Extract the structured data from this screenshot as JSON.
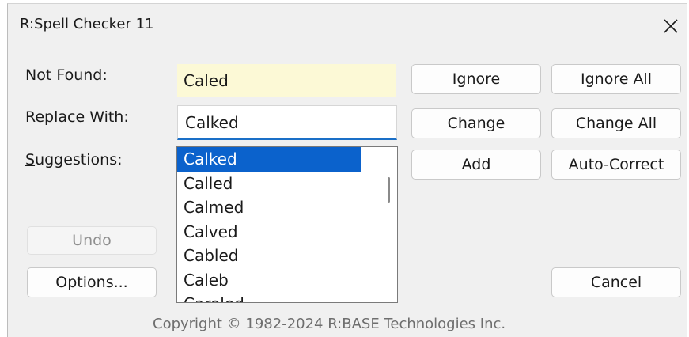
{
  "dialog": {
    "title": "R:Spell Checker 11",
    "close_icon": "close-icon"
  },
  "labels": {
    "not_found": "Not Found:",
    "replace_with_accel": "R",
    "replace_with_rest": "eplace With:",
    "suggestions_accel": "S",
    "suggestions_rest": "uggestions:"
  },
  "fields": {
    "not_found_value": "Caled",
    "replace_with_value": "Calked"
  },
  "suggestions": {
    "selected_index": 0,
    "items": [
      "Calked",
      "Called",
      "Calmed",
      "Calved",
      "Cabled",
      "Caleb",
      "Caroled"
    ]
  },
  "buttons": {
    "ignore": "Ignore",
    "ignore_all": "Ignore All",
    "change": "Change",
    "change_all": "Change All",
    "add": "Add",
    "auto_correct": "Auto-Correct",
    "undo": "Undo",
    "options": "Options...",
    "cancel": "Cancel"
  },
  "footer": {
    "copyright": "Copyright © 1982-2024 R:BASE Technologies Inc."
  },
  "colors": {
    "selection": "#0b62cc",
    "focus_underline": "#1a6fc7",
    "not_found_bg": "#fcf9d6"
  }
}
